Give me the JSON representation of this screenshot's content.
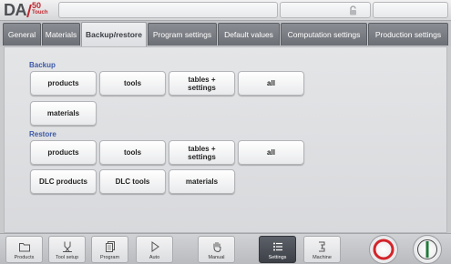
{
  "logo": {
    "main": "DA",
    "number": "50",
    "sub": "Touch"
  },
  "tabs": [
    {
      "label": "General",
      "active": false
    },
    {
      "label": "Materials",
      "active": false
    },
    {
      "label": "Backup/restore",
      "active": true
    },
    {
      "label": "Program settings",
      "active": false
    },
    {
      "label": "Default values",
      "active": false
    },
    {
      "label": "Computation settings",
      "active": false
    },
    {
      "label": "Production settings",
      "active": false
    }
  ],
  "backup": {
    "title": "Backup",
    "buttons": [
      "products",
      "tools",
      "tables +\nsettings",
      "all",
      "materials"
    ]
  },
  "restore": {
    "title": "Restore",
    "buttons": [
      "products",
      "tools",
      "tables +\nsettings",
      "all",
      "DLC products",
      "DLC tools",
      "materials"
    ]
  },
  "bottom_nav": [
    {
      "label": "Products",
      "icon": "folder-icon"
    },
    {
      "label": "Tool setup",
      "icon": "tool-icon"
    },
    {
      "label": "Program",
      "icon": "pages-icon"
    },
    {
      "label": "Auto",
      "icon": "play-icon"
    },
    {
      "label": "Manual",
      "icon": "hand-icon"
    },
    {
      "label": "Settings",
      "icon": "list-icon",
      "active": true
    },
    {
      "label": "Machine",
      "icon": "machine-icon"
    }
  ],
  "colors": {
    "accent": "#3d5aa7",
    "stop": "#d3242a",
    "start": "#1f7a3a",
    "active_tab_text": "#3a3d42"
  }
}
